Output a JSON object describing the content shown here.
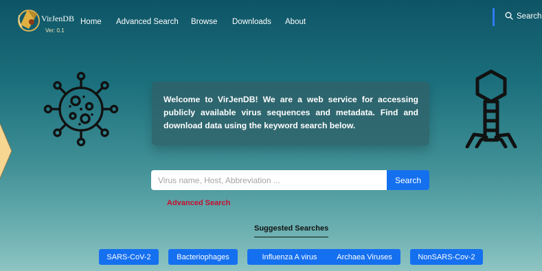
{
  "brand": {
    "name": "VirJenDB",
    "version": "Ver: 0.1"
  },
  "nav": {
    "home": "Home",
    "advanced_search": "Advanced Search",
    "browse": "Browse",
    "downloads": "Downloads",
    "about": "About",
    "search": "Search"
  },
  "welcome": {
    "text": "Welcome to VirJenDB! We are a web service for accessing publicly available virus sequences and metadata. Find and download data using the keyword search below."
  },
  "search": {
    "placeholder": "Virus name, Host, Abbreviation ...",
    "value": "",
    "button_label": "Search"
  },
  "advanced_link": "Advanced Search",
  "suggested": {
    "title": "Suggested Searches",
    "items": [
      "SARS-CoV-2",
      "Bacteriophages",
      "Influenza A virus",
      "Archaea Viruses",
      "NonSARS-Cov-2"
    ]
  },
  "colors": {
    "primary": "#1570f0",
    "link_red": "#c40f2e",
    "panel": "#326068",
    "background_top": "#0e5466",
    "background_bottom": "#8ec4c2",
    "arrow_fill": "#f7d692"
  },
  "icons": {
    "logo": "virus-logo-icon",
    "search": "search-icon",
    "virus": "coronavirus-icon",
    "phage": "bacteriophage-icon",
    "arrow": "arrow-right-icon"
  }
}
